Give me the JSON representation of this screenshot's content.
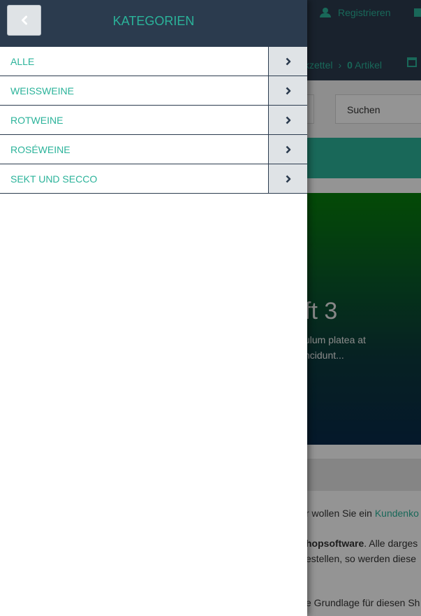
{
  "background": {
    "register_label": "Registrieren",
    "wishlist_label": "kzettel",
    "cart_count": "0",
    "cart_label": "Artikel",
    "search_placeholder": "Suchen",
    "hero_title": "ft 3",
    "hero_text_1": "ulum platea at",
    "hero_text_2": "ncidunt...",
    "info_line_1_prefix": "r wollen Sie ein ",
    "info_line_1_link": "Kundenko",
    "info_line_2_bold": "hopsoftware",
    "info_line_2_rest": ". Alle darges",
    "info_line_3": "estellen, so werden diese",
    "info_line_4": "e Grundlage für diesen Sh"
  },
  "offcanvas": {
    "title": "KATEGORIEN",
    "items": [
      {
        "label": "ALLE"
      },
      {
        "label": "WEISSWEINE"
      },
      {
        "label": "ROTWEINE"
      },
      {
        "label": "ROSÉWEINE"
      },
      {
        "label": "SEKT UND SECCO"
      }
    ]
  },
  "colors": {
    "header_bg": "#2b3b4e",
    "accent": "#2bb39a",
    "arrow_bg": "#dfe3e6"
  }
}
